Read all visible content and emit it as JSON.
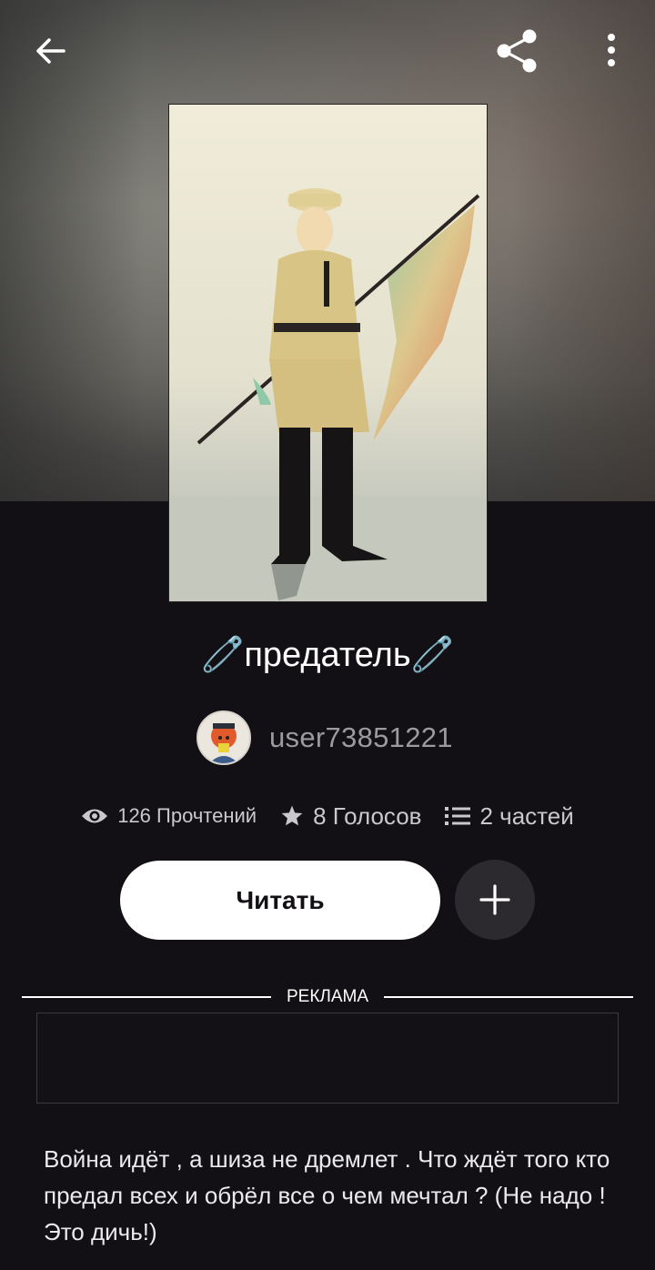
{
  "header": {
    "back_icon": "arrow-left-icon",
    "share_icon": "share-icon",
    "more_icon": "more-vertical-icon"
  },
  "story": {
    "title": "🧷предатель🧷",
    "author": "user73851221",
    "stats": {
      "reads": "126 Прочтений",
      "votes": "8 Голосов",
      "parts": "2 частей"
    },
    "read_button": "Читать",
    "description": "Война идёт , а шиза не дремлет . Что ждёт того кто предал всех и обрёл все о чем мечтал ? (Не надо ! Это дичь!)"
  },
  "ad": {
    "label": "РЕКЛАМА"
  },
  "colors": {
    "background": "#121014",
    "text": "#ffffff",
    "muted_text": "#9b9a9d",
    "add_button_bg": "#2c2a2e"
  }
}
